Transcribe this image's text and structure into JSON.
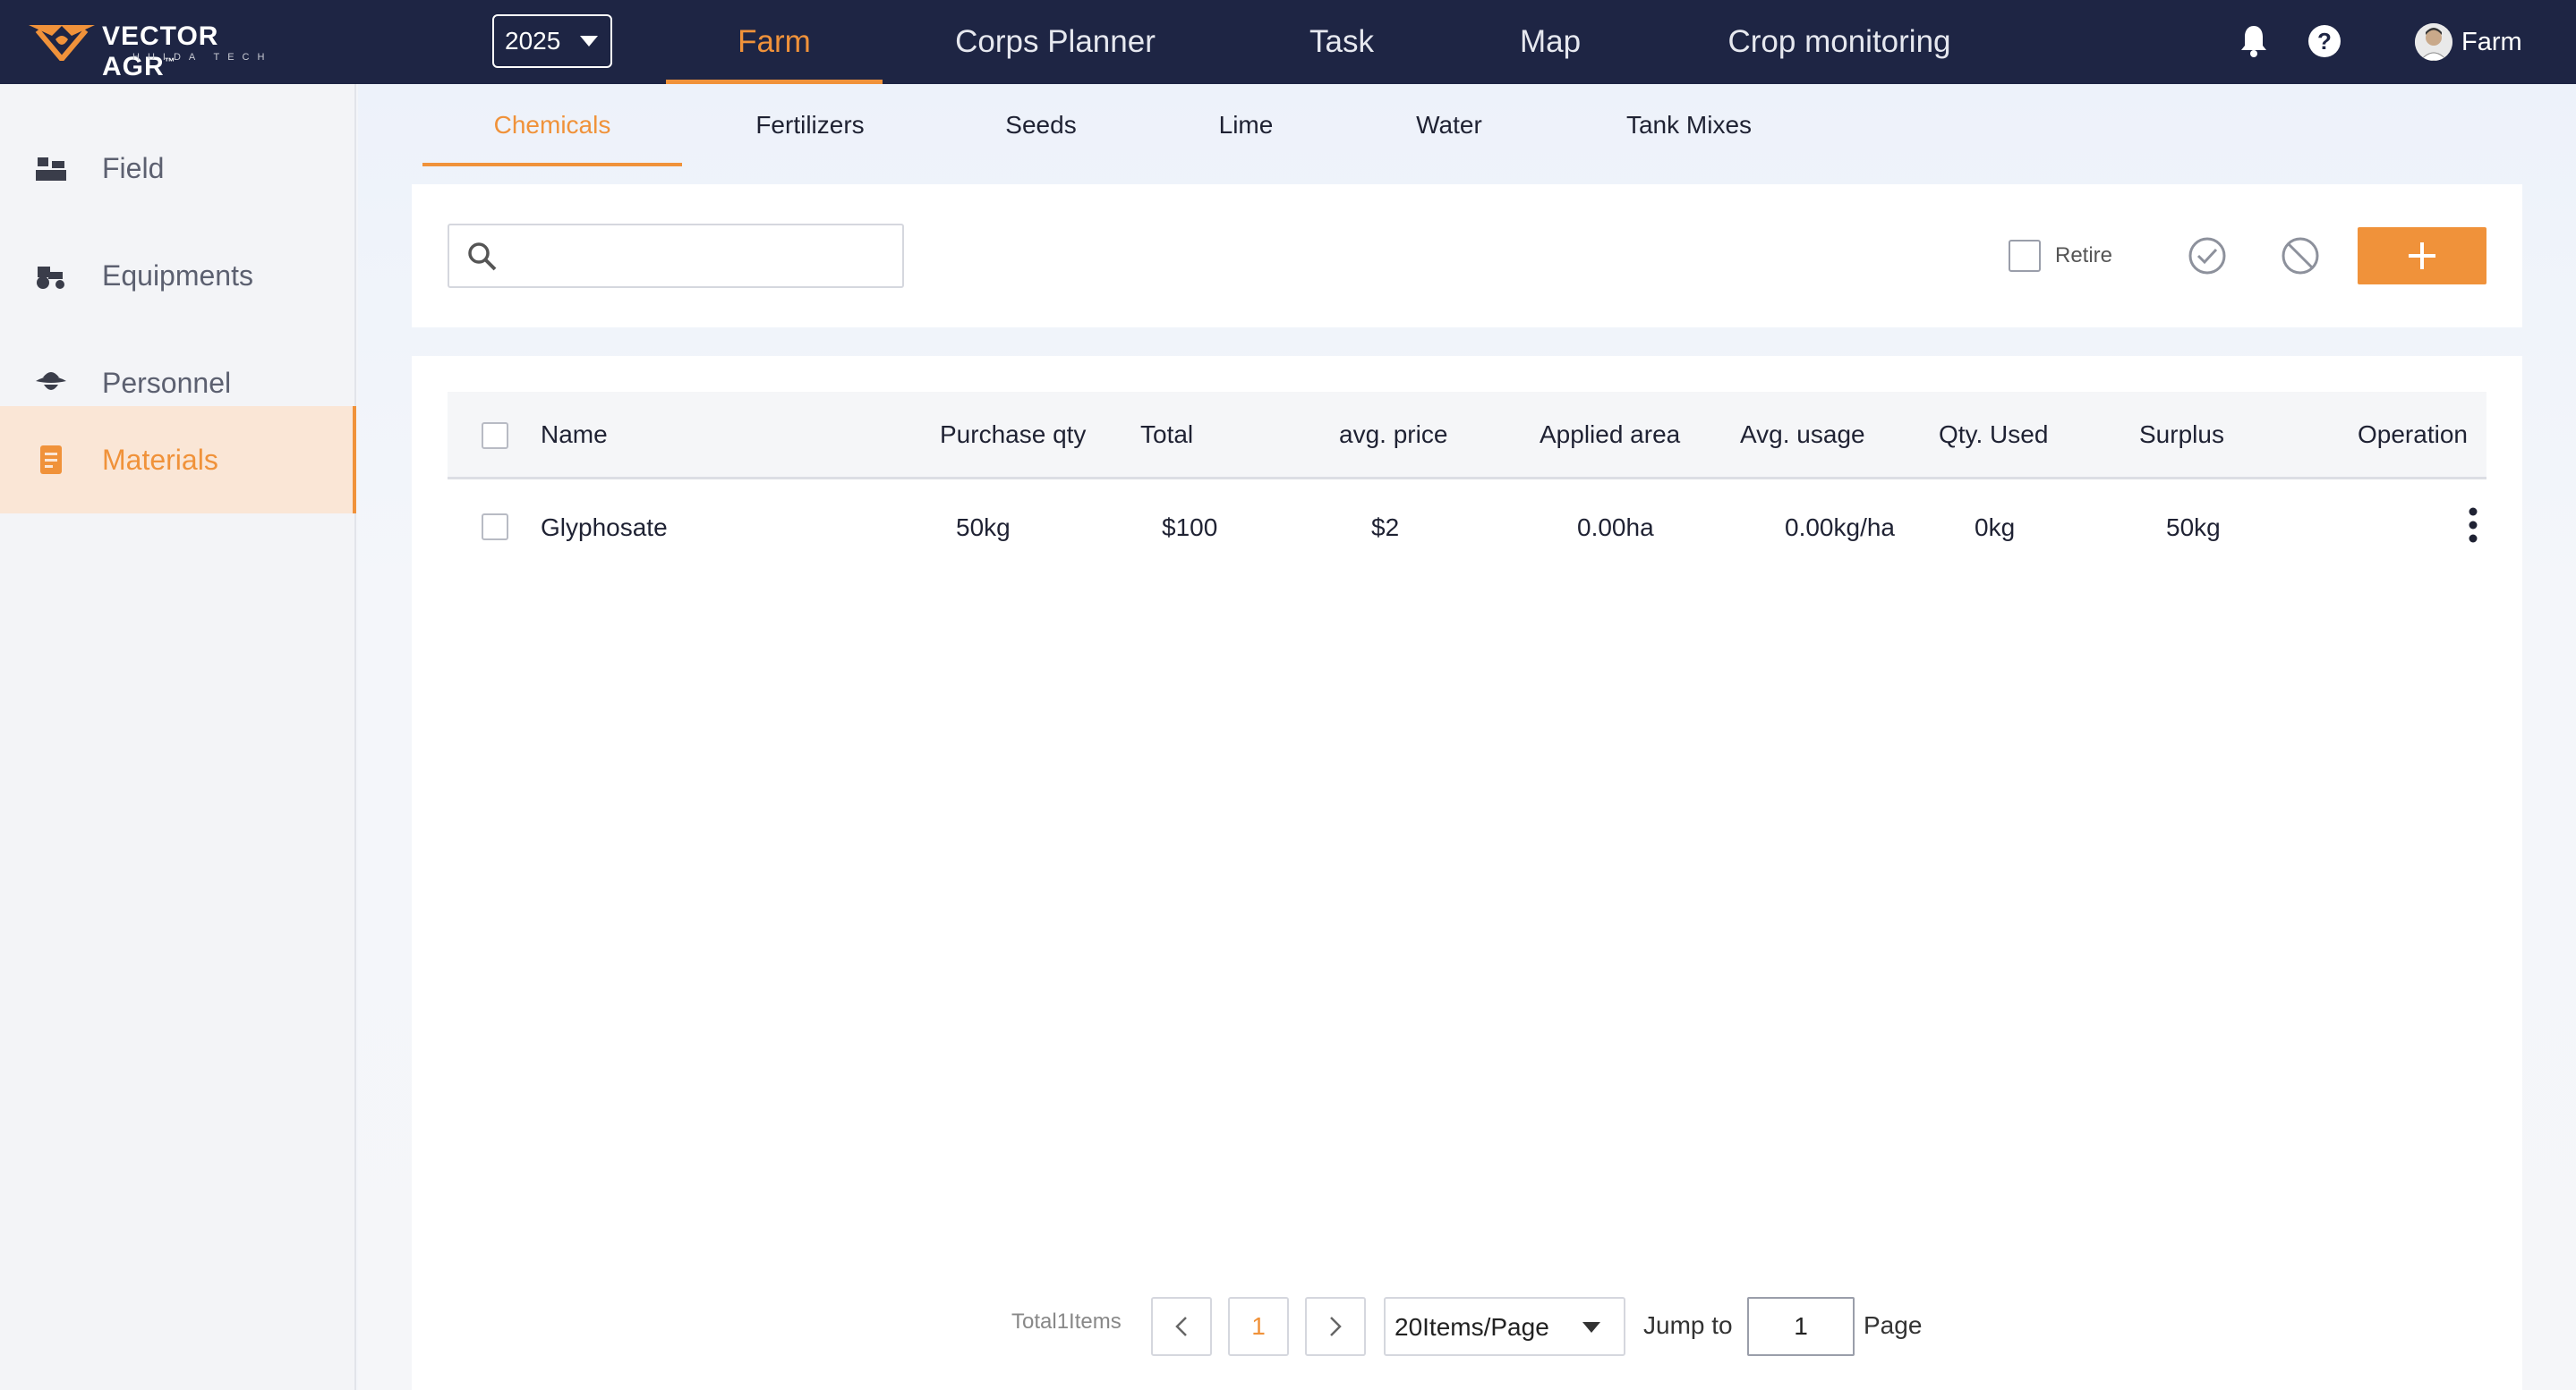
{
  "app": {
    "logo_text": "VECTOR AGR",
    "logo_tm": "™",
    "logo_sub": "HUIDA TECH",
    "year": "2025"
  },
  "nav": [
    {
      "label": "Farm",
      "active": true
    },
    {
      "label": "Corps Planner",
      "active": false
    },
    {
      "label": "Task",
      "active": false
    },
    {
      "label": "Map",
      "active": false
    },
    {
      "label": "Crop monitoring",
      "active": false
    }
  ],
  "user": {
    "name": "Farm"
  },
  "sidebar": {
    "items": [
      {
        "label": "Field",
        "icon": "field-icon"
      },
      {
        "label": "Equipments",
        "icon": "tractor-icon"
      },
      {
        "label": "Personnel",
        "icon": "farmer-hat-icon"
      },
      {
        "label": "Materials",
        "icon": "materials-icon",
        "active": true
      }
    ]
  },
  "subtabs": [
    {
      "label": "Chemicals",
      "active": true
    },
    {
      "label": "Fertilizers"
    },
    {
      "label": "Seeds"
    },
    {
      "label": "Lime"
    },
    {
      "label": "Water"
    },
    {
      "label": "Tank Mixes"
    }
  ],
  "toolbar": {
    "search_placeholder": "",
    "retire_label": "Retire"
  },
  "table": {
    "headers": [
      "Name",
      "Purchase qty",
      "Total",
      "avg. price",
      "Applied area",
      "Avg. usage",
      "Qty. Used",
      "Surplus",
      "Operation"
    ],
    "rows": [
      {
        "name": "Glyphosate",
        "purchase_qty": "50kg",
        "total": "$100",
        "avg_price": "$2",
        "applied_area": "0.00ha",
        "avg_usage": "0.00kg/ha",
        "qty_used": "0kg",
        "surplus": "50kg"
      }
    ]
  },
  "pagination": {
    "total_text": "Total1Items",
    "current_page": "1",
    "page_size": "20Items/Page",
    "jump_label": "Jump to",
    "jump_value": "1",
    "page_label": "Page"
  },
  "colors": {
    "topbar": "#1e2544",
    "accent": "#f0923a",
    "sidebar_active_bg": "#fae6d6"
  }
}
